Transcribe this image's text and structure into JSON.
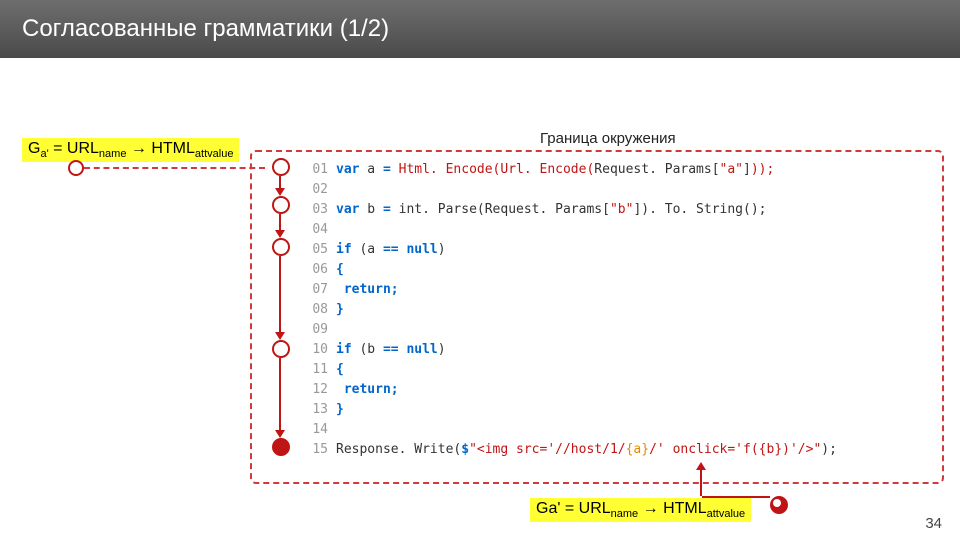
{
  "header": {
    "title": "Согласованные грамматики (1/2)"
  },
  "env_label": "Граница окружения",
  "formula_left": {
    "prefix": "G",
    "left_sub": "a'",
    "eq": " = URL",
    "sub1": "name",
    "arrow": " → HTML",
    "sub2": "attvalue"
  },
  "formula_bottom": {
    "prefix": "Ga' = URL",
    "sub1": "name",
    "arrow": " → HTML",
    "sub2": "attvalue"
  },
  "code": {
    "lines": [
      {
        "n": "01",
        "t": [
          {
            "s": "var",
            "c": "kw"
          },
          {
            "s": " a "
          },
          {
            "s": "=",
            "c": "kw"
          },
          {
            "s": " "
          },
          {
            "s": "Html. Encode(Url. Encode(",
            "c": "hl1"
          },
          {
            "s": "Request. Params["
          },
          {
            "s": "\"a\"",
            "c": "str"
          },
          {
            "s": "]"
          },
          {
            "s": "));",
            "c": "hl1"
          }
        ]
      },
      {
        "n": "02",
        "t": []
      },
      {
        "n": "03",
        "t": [
          {
            "s": "var",
            "c": "kw"
          },
          {
            "s": " b "
          },
          {
            "s": "=",
            "c": "kw"
          },
          {
            "s": " int. Parse(Request. Params["
          },
          {
            "s": "\"b\"",
            "c": "str"
          },
          {
            "s": "]). To. String();"
          }
        ]
      },
      {
        "n": "04",
        "t": []
      },
      {
        "n": "05",
        "t": [
          {
            "s": "if",
            "c": "kw"
          },
          {
            "s": " (a "
          },
          {
            "s": "== null",
            "c": "kw"
          },
          {
            "s": ")"
          }
        ]
      },
      {
        "n": "06",
        "t": [
          {
            "s": "{",
            "c": "kw"
          }
        ]
      },
      {
        "n": "07",
        "t": [
          {
            "s": "  "
          },
          {
            "s": "return;",
            "c": "kw"
          }
        ]
      },
      {
        "n": "08",
        "t": [
          {
            "s": "}",
            "c": "kw"
          }
        ]
      },
      {
        "n": "09",
        "t": []
      },
      {
        "n": "10",
        "t": [
          {
            "s": "if",
            "c": "kw"
          },
          {
            "s": " (b "
          },
          {
            "s": "== null",
            "c": "kw"
          },
          {
            "s": ")"
          }
        ]
      },
      {
        "n": "11",
        "t": [
          {
            "s": "{",
            "c": "kw"
          }
        ]
      },
      {
        "n": "12",
        "t": [
          {
            "s": "  "
          },
          {
            "s": "return;",
            "c": "kw"
          }
        ]
      },
      {
        "n": "13",
        "t": [
          {
            "s": "}",
            "c": "kw"
          }
        ]
      },
      {
        "n": "14",
        "t": []
      },
      {
        "n": "15",
        "t": [
          {
            "s": "Response. Write("
          },
          {
            "s": "$",
            "c": "kw"
          },
          {
            "s": "\"<img src='//host/1/",
            "c": "str"
          },
          {
            "s": "{a}",
            "c": "hl2"
          },
          {
            "s": "/' onclick='f({b})'/>\"",
            "c": "str"
          },
          {
            "s": ");"
          }
        ]
      }
    ]
  },
  "page_number": "34"
}
